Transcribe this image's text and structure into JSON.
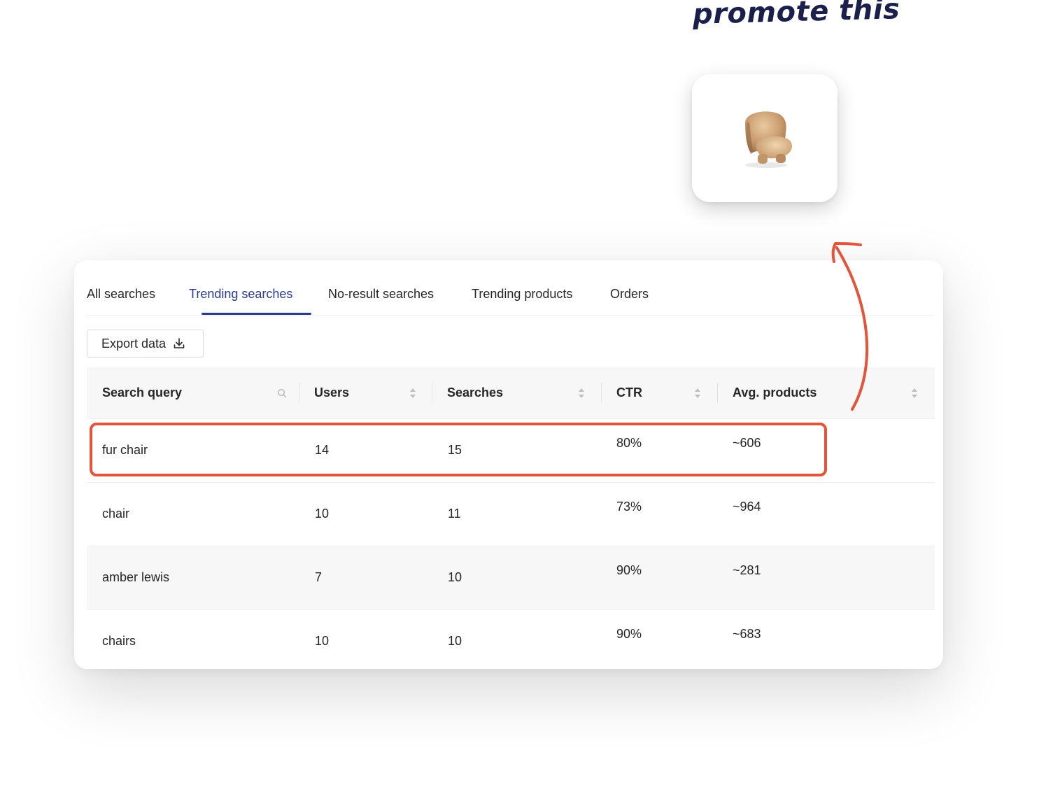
{
  "annotation": {
    "text": "promote this"
  },
  "product": {
    "icon": "armchair-icon",
    "name": "fur chair"
  },
  "tabs": [
    {
      "label": "All searches",
      "active": false
    },
    {
      "label": "Trending searches",
      "active": true
    },
    {
      "label": "No-result searches",
      "active": false
    },
    {
      "label": "Trending products",
      "active": false
    },
    {
      "label": "Orders",
      "active": false
    }
  ],
  "toolbar": {
    "export_label": "Export data",
    "export_icon": "download-icon"
  },
  "table": {
    "columns": [
      {
        "label": "Search query",
        "icon": "search-icon"
      },
      {
        "label": "Users",
        "icon": "sort-icon"
      },
      {
        "label": "Searches",
        "icon": "sort-icon"
      },
      {
        "label": "CTR",
        "icon": "sort-icon"
      },
      {
        "label": "Avg. products",
        "icon": "sort-icon"
      }
    ],
    "rows": [
      {
        "query": "fur chair",
        "users": "14",
        "searches": "15",
        "ctr": "80%",
        "avg_products": "~606",
        "highlighted": true
      },
      {
        "query": "chair",
        "users": "10",
        "searches": "11",
        "ctr": "73%",
        "avg_products": "~964",
        "highlighted": false
      },
      {
        "query": "amber lewis",
        "users": "7",
        "searches": "10",
        "ctr": "90%",
        "avg_products": "~281",
        "highlighted": false
      },
      {
        "query": "chairs",
        "users": "10",
        "searches": "10",
        "ctr": "90%",
        "avg_products": "~683",
        "highlighted": false
      }
    ]
  },
  "colors": {
    "accent": "#2a3a8f",
    "highlight": "#e2553a",
    "annotation": "#1a1f4b",
    "header_bg": "#f7f7f7"
  }
}
